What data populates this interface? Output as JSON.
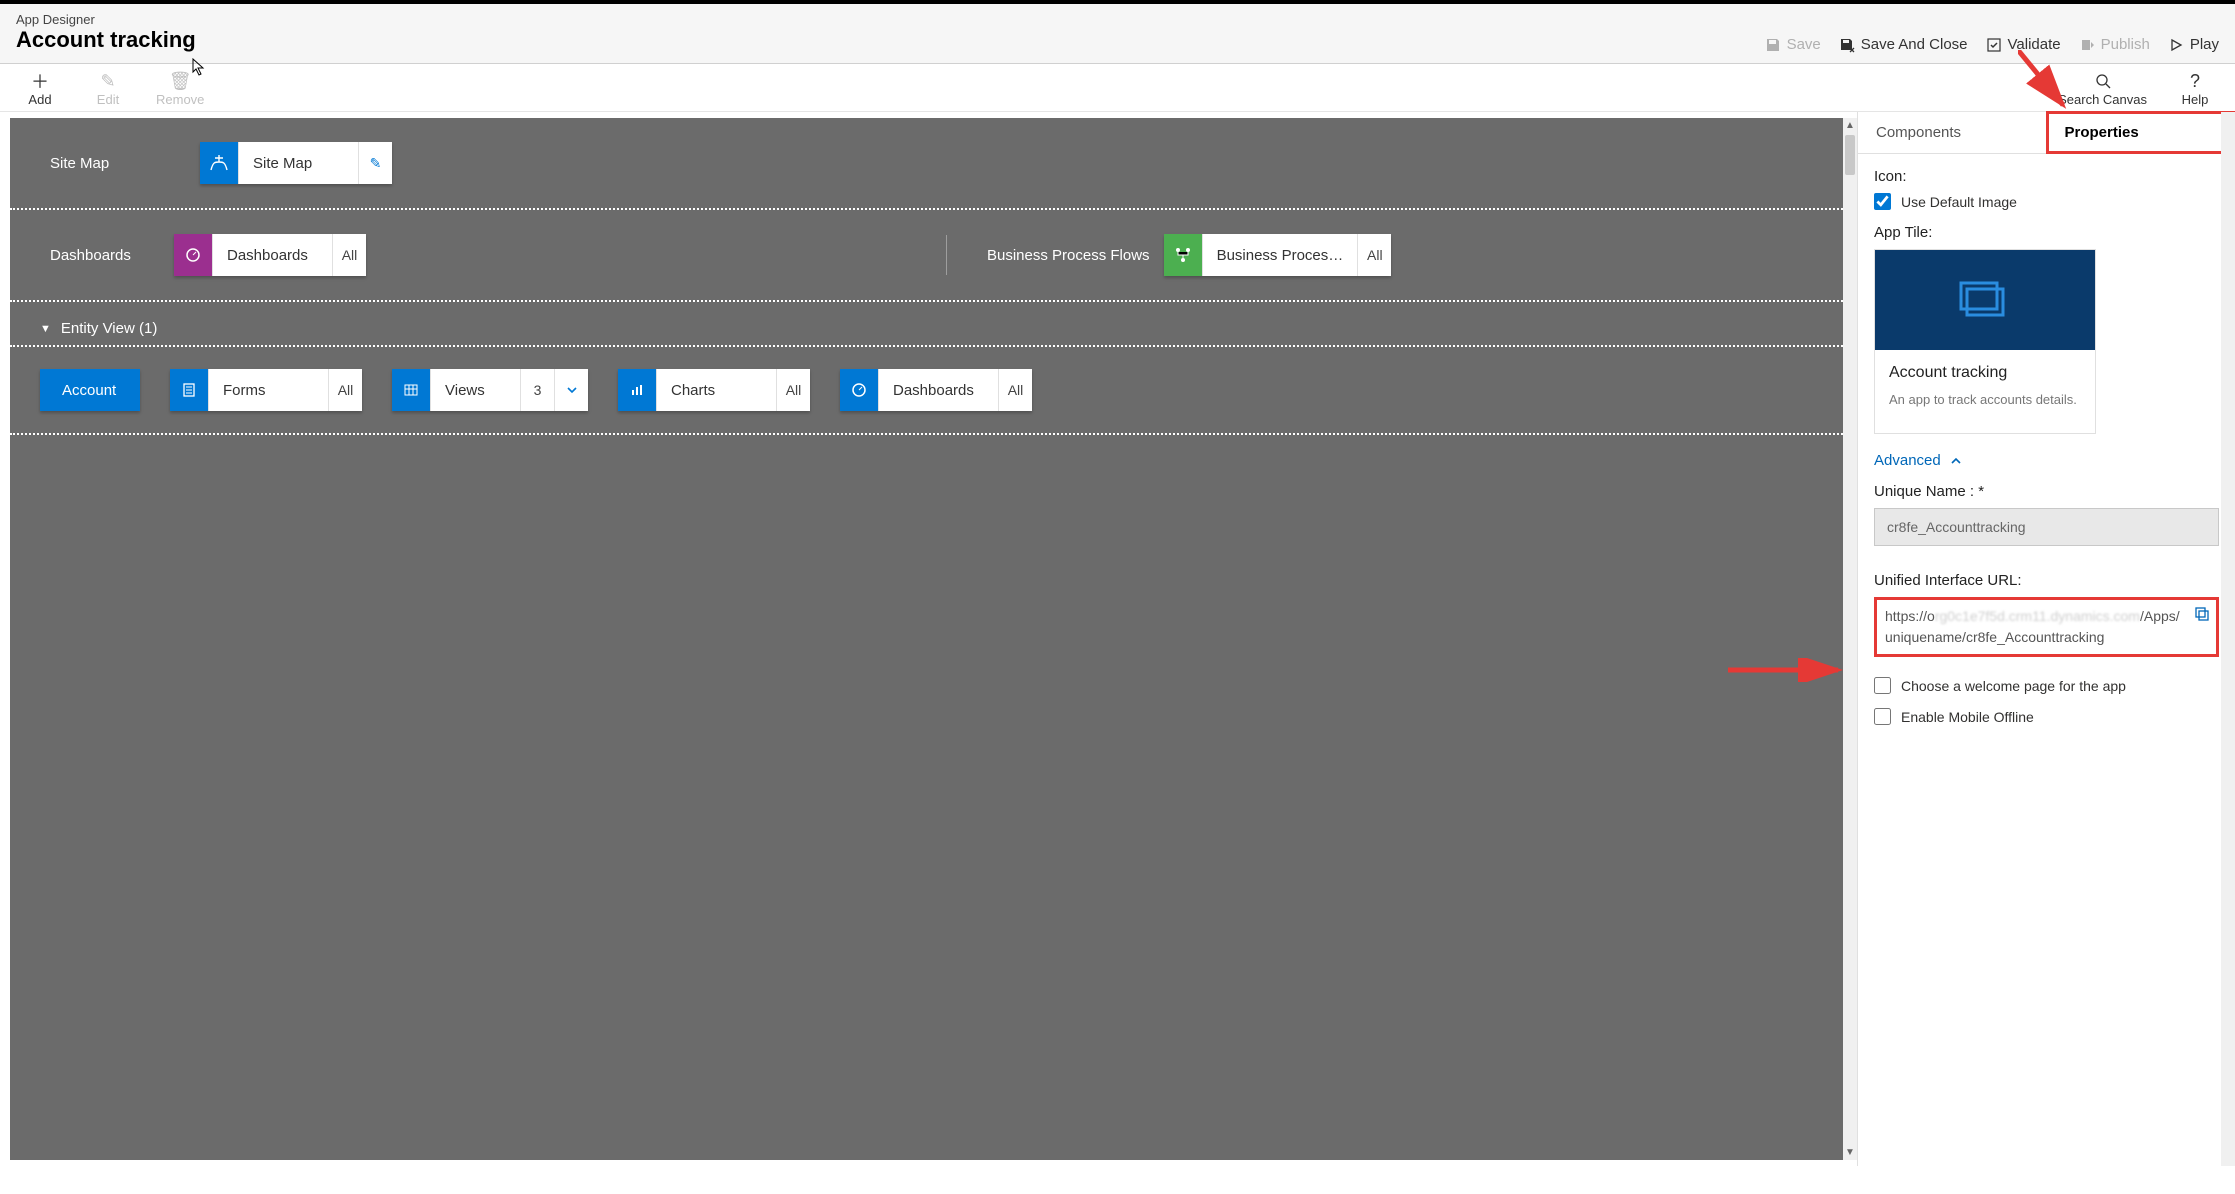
{
  "header": {
    "subtitle": "App Designer",
    "title": "Account tracking",
    "buttons": {
      "save": "Save",
      "save_close": "Save And Close",
      "validate": "Validate",
      "publish": "Publish",
      "play": "Play"
    }
  },
  "toolbar": {
    "add": "Add",
    "edit": "Edit",
    "remove": "Remove",
    "search": "Search Canvas",
    "help": "Help"
  },
  "canvas": {
    "sitemap_label": "Site Map",
    "sitemap_tile": "Site Map",
    "dashboards_label": "Dashboards",
    "dashboards_tile": "Dashboards",
    "dashboards_suffix": "All",
    "bpf_label": "Business Process Flows",
    "bpf_tile": "Business Proces…",
    "bpf_suffix": "All",
    "entity_header": "Entity View (1)",
    "entity_chip": "Account",
    "forms_tile": "Forms",
    "forms_suffix": "All",
    "views_tile": "Views",
    "views_suffix": "3",
    "charts_tile": "Charts",
    "charts_suffix": "All",
    "ent_dash_tile": "Dashboards",
    "ent_dash_suffix": "All"
  },
  "tabs": {
    "components": "Components",
    "properties": "Properties"
  },
  "props": {
    "icon_label": "Icon:",
    "use_default": "Use Default Image",
    "app_tile_label": "App Tile:",
    "tile_title": "Account tracking",
    "tile_desc": "An app to track accounts details.",
    "advanced": "Advanced",
    "unique_name_label": "Unique Name : *",
    "unique_name_value": "cr8fe_Accounttracking",
    "url_label": "Unified Interface URL:",
    "url_prefix": "https://o",
    "url_blur": "rg0c1e7f5d.crm11.dynamics.com",
    "url_suffix": "/Apps/uniquename/cr8fe_Accounttracking",
    "welcome": "Choose a welcome page for the app",
    "mobile": "Enable Mobile Offline"
  }
}
